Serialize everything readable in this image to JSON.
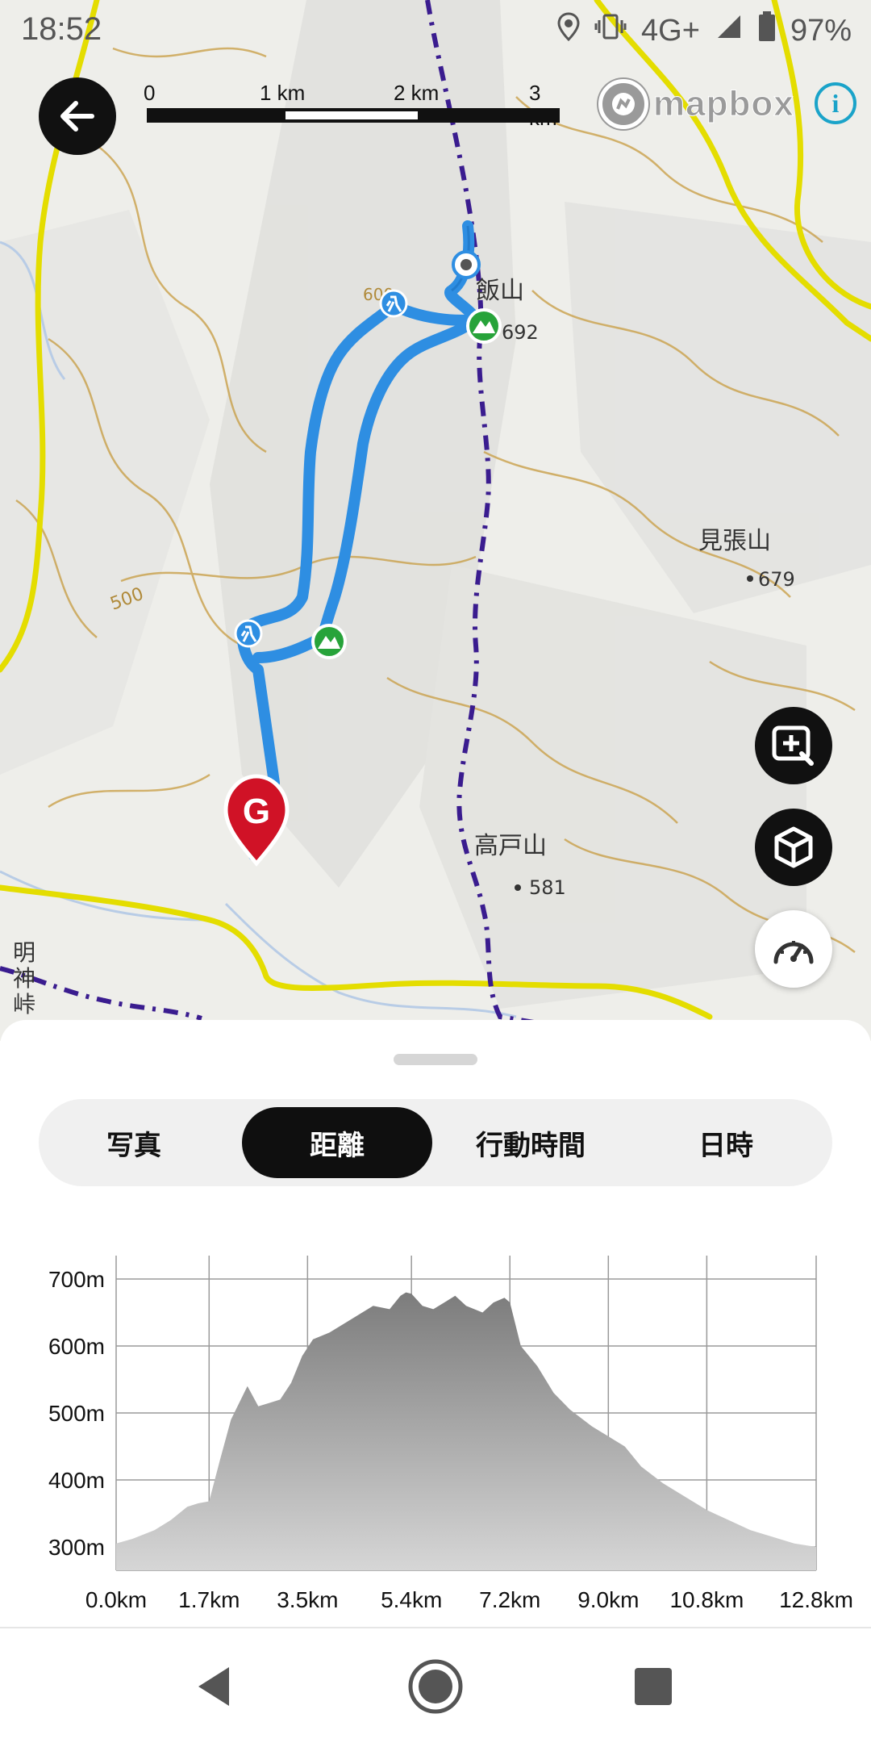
{
  "status_bar": {
    "time": "18:52",
    "network": "4G+",
    "battery": "97%",
    "icons": [
      "location-icon",
      "vibrate-icon",
      "signal-icon",
      "battery-icon"
    ]
  },
  "map": {
    "scale": {
      "labels": [
        "0",
        "1 km",
        "2 km",
        "3 km"
      ]
    },
    "attribution": "mapbox",
    "info_icon": "i",
    "labels": {
      "peak1_name": "飯山",
      "peak1_elev": "692",
      "peak2_name": "見張山",
      "peak2_elev": "679",
      "peak3_name": "高戸山",
      "peak3_elev": "581",
      "contour": "500",
      "contour2": "600",
      "pass": "明神峠"
    },
    "colors": {
      "route": "#2f8fe0",
      "road": "#e6e000",
      "trail": "#3a1c8f",
      "contour": "#c9a04a",
      "goal": "#d01226",
      "summit": "#27a33a"
    },
    "goal_marker": "G"
  },
  "tabs": [
    {
      "label": "写真",
      "active": false
    },
    {
      "label": "距離",
      "active": true
    },
    {
      "label": "行動時間",
      "active": false
    },
    {
      "label": "日時",
      "active": false
    }
  ],
  "chart_data": {
    "type": "area",
    "x_unit": "km",
    "y_unit": "m",
    "xlim": [
      0,
      12.8
    ],
    "ylim": [
      265,
      735
    ],
    "x_ticks": [
      "0.0km",
      "1.7km",
      "3.5km",
      "5.4km",
      "7.2km",
      "9.0km",
      "10.8km",
      "12.8km"
    ],
    "y_ticks": [
      "700m",
      "600m",
      "500m",
      "400m",
      "300m"
    ],
    "grid": true,
    "x": [
      0.0,
      0.3,
      0.7,
      1.0,
      1.3,
      1.5,
      1.7,
      1.9,
      2.1,
      2.4,
      2.6,
      2.8,
      3.0,
      3.2,
      3.4,
      3.6,
      3.9,
      4.2,
      4.5,
      4.7,
      5.0,
      5.2,
      5.3,
      5.4,
      5.6,
      5.8,
      6.0,
      6.2,
      6.4,
      6.7,
      6.9,
      7.1,
      7.2,
      7.4,
      7.7,
      8.0,
      8.3,
      8.7,
      9.0,
      9.3,
      9.6,
      10.0,
      10.4,
      10.8,
      11.2,
      11.6,
      12.0,
      12.4,
      12.8
    ],
    "y": [
      305,
      312,
      325,
      340,
      360,
      365,
      368,
      430,
      490,
      540,
      510,
      515,
      520,
      545,
      585,
      610,
      620,
      635,
      650,
      660,
      655,
      675,
      680,
      678,
      660,
      655,
      665,
      675,
      660,
      650,
      665,
      672,
      665,
      600,
      570,
      530,
      505,
      480,
      465,
      450,
      420,
      395,
      375,
      355,
      340,
      325,
      315,
      305,
      300
    ]
  },
  "nav_bar": {
    "icons": [
      "back-triangle-icon",
      "home-circle-icon",
      "recents-square-icon"
    ]
  }
}
